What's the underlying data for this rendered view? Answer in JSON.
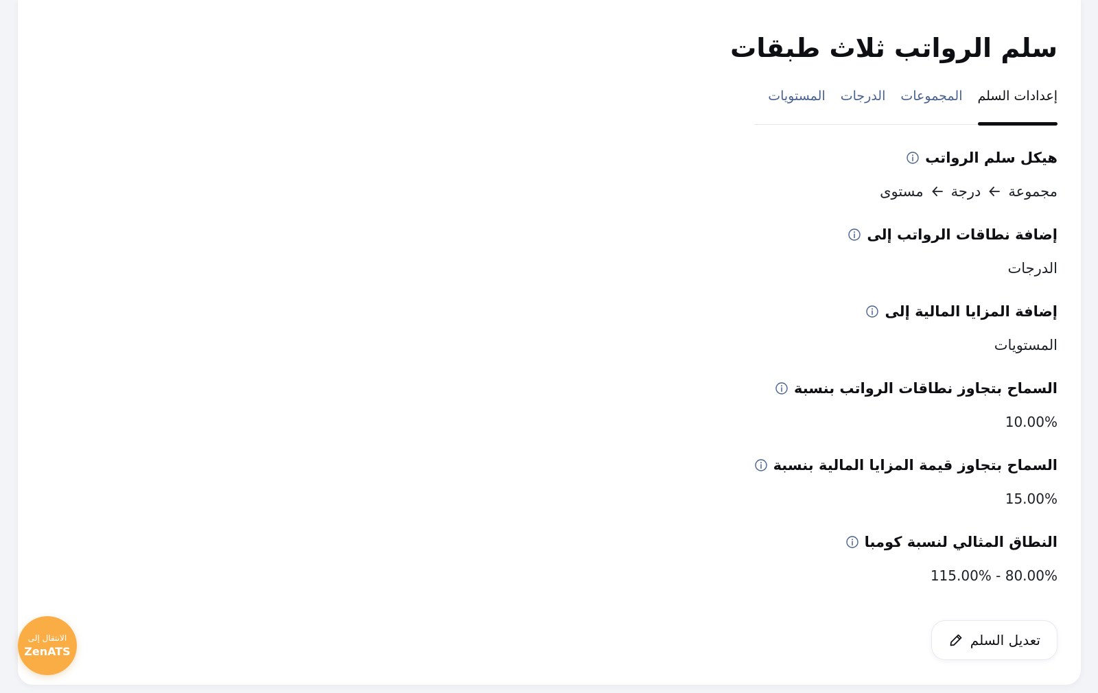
{
  "page": {
    "title": "سلم الرواتب ثلاث طبقات"
  },
  "tabs": [
    {
      "label": "إعدادات السلم",
      "active": true
    },
    {
      "label": "المجموعات",
      "active": false
    },
    {
      "label": "الدرجات",
      "active": false
    },
    {
      "label": "المستويات",
      "active": false
    }
  ],
  "settings": {
    "structure": {
      "label": "هيكل سلم الرواتب",
      "path": [
        "مجموعة",
        "درجة",
        "مستوى"
      ],
      "separator_icon": "arrow-left-icon"
    },
    "salary_ranges_target": {
      "label": "إضافة نطاقات الرواتب إلى",
      "value": "الدرجات"
    },
    "benefits_target": {
      "label": "إضافة المزايا المالية إلى",
      "value": "المستويات"
    },
    "salary_range_overrun": {
      "label": "السماح بتجاوز نطاقات الرواتب بنسبة",
      "value": "10.00%"
    },
    "benefits_overrun": {
      "label": "السماح بتجاوز قيمة المزايا المالية بنسبة",
      "value": "15.00%"
    },
    "compa_ratio_range": {
      "label": "النطاق المثالي لنسبة كومبا",
      "value": "115.00% - 80.00%"
    }
  },
  "actions": {
    "edit_label": "تعديل السلم",
    "edit_icon": "pencil-icon"
  },
  "badge": {
    "line1": "الانتقال إلى",
    "line2": "ZenATS"
  },
  "colors": {
    "accent_text": "#4a6290",
    "badge": "#fbad45",
    "page_background": "#f3f4f8"
  }
}
